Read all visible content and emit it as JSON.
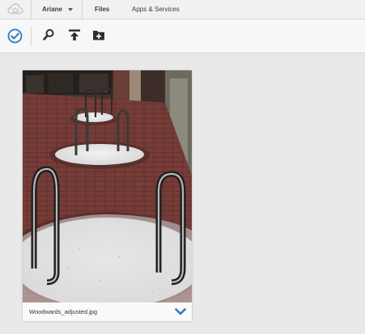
{
  "nav": {
    "user_name": "Ariane",
    "files_label": "Files",
    "apps_label": "Apps & Services",
    "logo_icon": "creative-cloud-logo-icon"
  },
  "toolbar": {
    "buttons": [
      "select-checkmark-icon",
      "search-icon",
      "upload-icon",
      "new-folder-icon"
    ],
    "accent_color": "#2b79c6"
  },
  "files": [
    {
      "name": "Woodwards_adjusted.jpg",
      "thumbnail": "bike-rack-on-brick-plaza"
    }
  ]
}
